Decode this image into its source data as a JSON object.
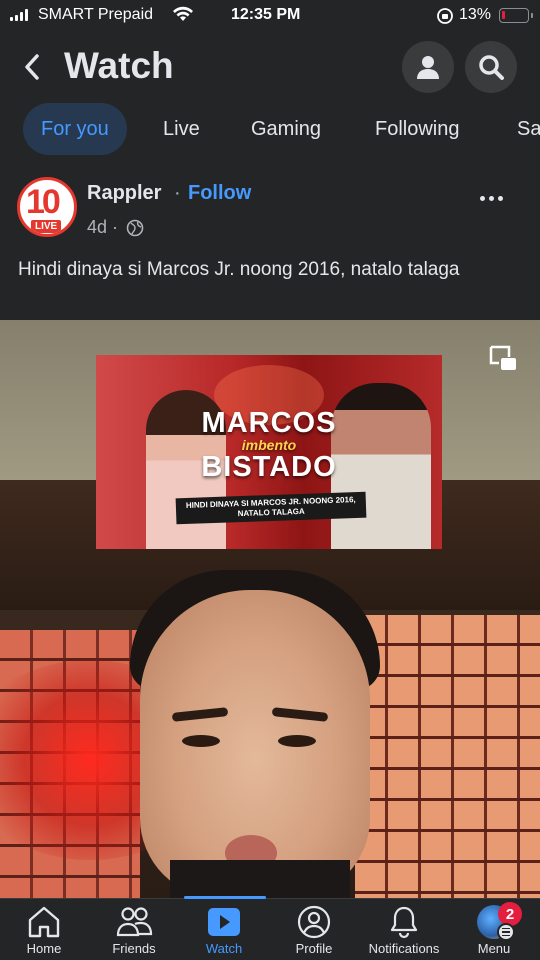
{
  "status_bar": {
    "carrier": "SMART Prepaid",
    "time": "12:35 PM",
    "battery_percent": "13%",
    "battery_level": 0.13,
    "battery_color": "#e41e3f"
  },
  "header": {
    "title": "Watch",
    "back_icon": "chevron-left-icon",
    "profile_icon": "person-icon",
    "search_icon": "search-icon"
  },
  "tabs": [
    {
      "label": "For you",
      "active": true
    },
    {
      "label": "Live",
      "active": false
    },
    {
      "label": "Gaming",
      "active": false
    },
    {
      "label": "Following",
      "active": false
    },
    {
      "label": "Sa",
      "active": false
    }
  ],
  "post": {
    "page_name": "Rappler",
    "separator": "·",
    "follow_label": "Follow",
    "time_ago": "4d ·",
    "avatar_text": "10",
    "avatar_badge": "LIVE",
    "caption": "Hindi dinaya si Marcos Jr. noong 2016, natalo talaga",
    "thumbnail": {
      "title_top": "MARCOS",
      "title_mid": "imbento",
      "title_bottom": "BISTADO",
      "subtitle": "HINDI DINAYA SI MARCOS JR. NOONG 2016, NATALO TALAGA"
    }
  },
  "nav": {
    "items": [
      {
        "label": "Home",
        "icon": "home-icon"
      },
      {
        "label": "Friends",
        "icon": "friends-icon"
      },
      {
        "label": "Watch",
        "icon": "watch-icon",
        "active": true
      },
      {
        "label": "Profile",
        "icon": "profile-icon"
      },
      {
        "label": "Notifications",
        "icon": "bell-icon"
      },
      {
        "label": "Menu",
        "icon": "menu-icon"
      }
    ],
    "menu_badge": "2"
  },
  "colors": {
    "background": "#242526",
    "accent": "#4599ff",
    "active_tab_bg": "#263951",
    "badge": "#e41e3f"
  }
}
